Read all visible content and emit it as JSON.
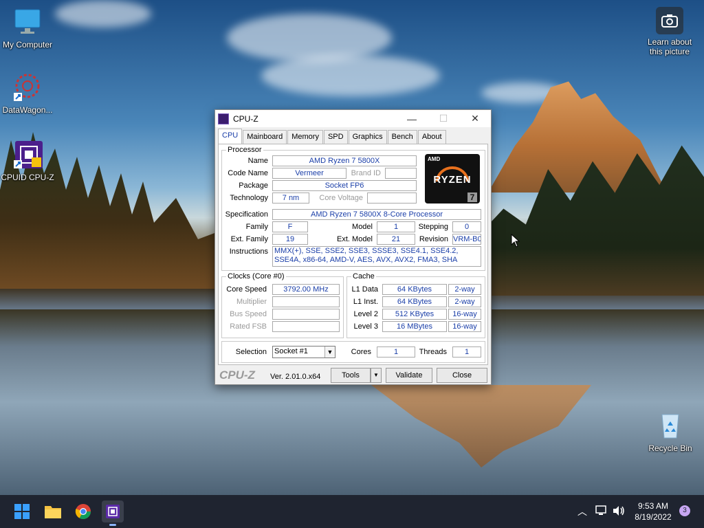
{
  "desktop": {
    "icons": {
      "my_computer": "My Computer",
      "datawagon": "DataWagon...",
      "cpuz": "CPUID CPU-Z",
      "recycle_bin": "Recycle Bin"
    },
    "learn_picture": [
      "Learn about",
      "this picture"
    ]
  },
  "window": {
    "title": "CPU-Z",
    "controls": {
      "minimize": "—",
      "maximize": "☐",
      "close": "✕"
    },
    "tabs": [
      "CPU",
      "Mainboard",
      "Memory",
      "SPD",
      "Graphics",
      "Bench",
      "About"
    ],
    "active_tab": "CPU",
    "processor": {
      "legend": "Processor",
      "name_label": "Name",
      "name": "AMD Ryzen 7 5800X",
      "codename_label": "Code Name",
      "codename": "Vermeer",
      "brandid_label": "Brand ID",
      "brandid": "",
      "package_label": "Package",
      "package": "Socket FP6",
      "technology_label": "Technology",
      "technology": "7 nm",
      "corevoltage_label": "Core Voltage",
      "corevoltage": "",
      "spec_label": "Specification",
      "spec": "AMD Ryzen 7 5800X 8-Core Processor",
      "family_label": "Family",
      "family": "F",
      "model_label": "Model",
      "model": "1",
      "stepping_label": "Stepping",
      "stepping": "0",
      "extfamily_label": "Ext. Family",
      "extfamily": "19",
      "extmodel_label": "Ext. Model",
      "extmodel": "21",
      "revision_label": "Revision",
      "revision": "VRM-B0",
      "instructions_label": "Instructions",
      "instructions": "MMX(+), SSE, SSE2, SSE3, SSSE3, SSE4.1, SSE4.2, SSE4A, x86-64, AMD-V, AES, AVX, AVX2, FMA3, SHA"
    },
    "logo": {
      "brand": "AMD",
      "name": "RYZEN",
      "tier": "7"
    },
    "clocks": {
      "legend": "Clocks (Core #0)",
      "corespeed_label": "Core Speed",
      "corespeed": "3792.00 MHz",
      "multiplier_label": "Multiplier",
      "multiplier": "",
      "busspeed_label": "Bus Speed",
      "busspeed": "",
      "ratedfsb_label": "Rated FSB",
      "ratedfsb": ""
    },
    "cache": {
      "legend": "Cache",
      "rows": [
        {
          "label": "L1 Data",
          "size": "64 KBytes",
          "way": "2-way"
        },
        {
          "label": "L1 Inst.",
          "size": "64 KBytes",
          "way": "2-way"
        },
        {
          "label": "Level 2",
          "size": "512 KBytes",
          "way": "16-way"
        },
        {
          "label": "Level 3",
          "size": "16 MBytes",
          "way": "16-way"
        }
      ]
    },
    "selection": {
      "label": "Selection",
      "value": "Socket #1",
      "cores_label": "Cores",
      "cores": "1",
      "threads_label": "Threads",
      "threads": "1"
    },
    "footer": {
      "brand": "CPU-Z",
      "version": "Ver. 2.01.0.x64",
      "tools": "Tools",
      "validate": "Validate",
      "close": "Close"
    }
  },
  "taskbar": {
    "time": "9:53 AM",
    "date": "8/19/2022",
    "notification_count": "3"
  }
}
